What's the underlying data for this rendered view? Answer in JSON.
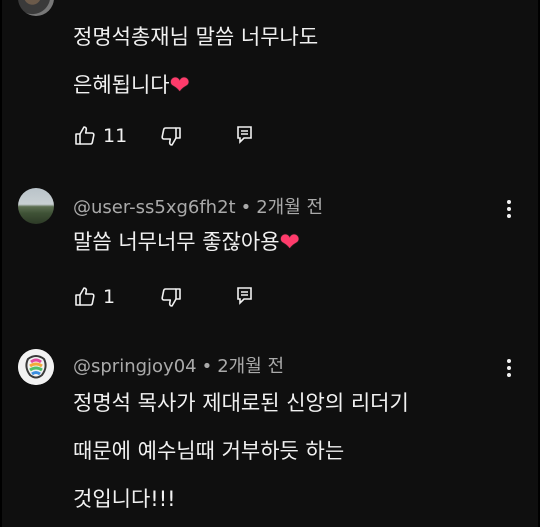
{
  "comments": [
    {
      "author": "",
      "time": "",
      "lines": [
        "정명석총재님 말씀 너무나도",
        "은혜됩니다"
      ],
      "emoji": "❤",
      "likes": "11"
    },
    {
      "author": "@user-ss5xg6fh2t",
      "time": "2개월 전",
      "lines": [
        "말씀 너무너무 좋잖아용"
      ],
      "emoji": "❤",
      "likes": "1"
    },
    {
      "author": "@springjoy04",
      "time": "2개월 전",
      "lines": [
        "정명석 목사가 제대로된 신앙의 리더기",
        "때문에 예수님때 거부하듯 하는",
        "것입니다!!!"
      ],
      "emoji": "",
      "likes": ""
    }
  ],
  "meta_separator": "•",
  "icons": {
    "like": "thumb-up-icon",
    "dislike": "thumb-down-icon",
    "reply": "reply-icon",
    "more": "more-vert-icon"
  },
  "colors": {
    "background": "#0f0f0f",
    "text": "#f1f1f1",
    "meta": "#aaaaaa",
    "heart": "#ff3b6b"
  }
}
